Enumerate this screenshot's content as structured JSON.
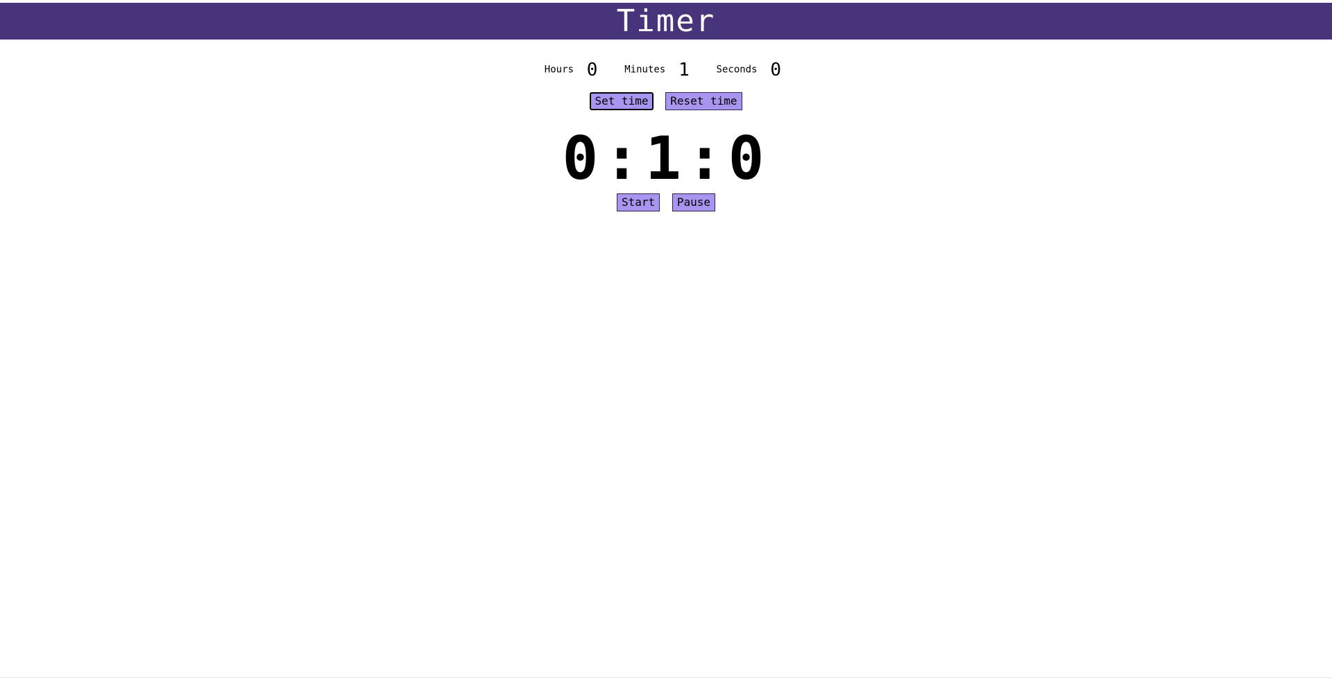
{
  "header": {
    "title": "Timer"
  },
  "inputs": {
    "hours_label": "Hours",
    "hours_value": "0",
    "minutes_label": "Minutes",
    "minutes_value": "1",
    "seconds_label": "Seconds",
    "seconds_value": "0"
  },
  "actions": {
    "set_label": "Set time",
    "reset_label": "Reset time"
  },
  "display": {
    "time": "0:1:0"
  },
  "controls": {
    "start_label": "Start",
    "pause_label": "Pause"
  },
  "colors": {
    "header_bg": "#48347a",
    "button_bg": "#a795ef"
  }
}
